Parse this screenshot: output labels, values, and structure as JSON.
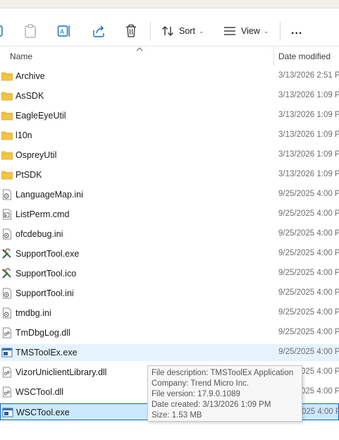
{
  "toolbar": {
    "sort_label": "Sort",
    "view_label": "View",
    "more_label": "..."
  },
  "header": {
    "name_label": "Name",
    "date_label": "Date modified"
  },
  "files": [
    {
      "name": "Archive",
      "date": "3/13/2026 2:51 P",
      "icon": "folder-icon"
    },
    {
      "name": "AsSDK",
      "date": "3/13/2026 1:09 P",
      "icon": "folder-icon"
    },
    {
      "name": "EagleEyeUtil",
      "date": "3/13/2026 1:09 P",
      "icon": "folder-icon"
    },
    {
      "name": "l10n",
      "date": "3/13/2026 1:09 P",
      "icon": "folder-icon"
    },
    {
      "name": "OspreyUtil",
      "date": "3/13/2026 1:09 P",
      "icon": "folder-icon"
    },
    {
      "name": "PtSDK",
      "date": "3/13/2026 1:09 P",
      "icon": "folder-icon"
    },
    {
      "name": "LanguageMap.ini",
      "date": "9/25/2025 4:00 P",
      "icon": "settings-file-icon"
    },
    {
      "name": "ListPerm.cmd",
      "date": "9/25/2025 4:00 P",
      "icon": "cmd-file-icon"
    },
    {
      "name": "ofcdebug.ini",
      "date": "9/25/2025 4:00 P",
      "icon": "settings-file-icon"
    },
    {
      "name": "SupportTool.exe",
      "date": "9/25/2025 4:00 P",
      "icon": "tools-icon"
    },
    {
      "name": "SupportTool.ico",
      "date": "9/25/2025 4:00 P",
      "icon": "tools-icon"
    },
    {
      "name": "SupportTool.ini",
      "date": "9/25/2025 4:00 P",
      "icon": "settings-file-icon"
    },
    {
      "name": "tmdbg.ini",
      "date": "9/25/2025 4:00 P",
      "icon": "settings-file-icon"
    },
    {
      "name": "TmDbgLog.dll",
      "date": "9/25/2025 4:00 P",
      "icon": "dll-file-icon"
    },
    {
      "name": "TMSToolEx.exe",
      "date": "9/25/2025 4:00 P",
      "icon": "exe-file-icon"
    },
    {
      "name": "VizorUniclientLibrary.dll",
      "date": "9/25/2025 4:00 P",
      "icon": "dll-file-icon"
    },
    {
      "name": "WSCTool.dll",
      "date": "9/25/2025 4:00 P",
      "icon": "dll-file-icon"
    },
    {
      "name": "WSCTool.exe",
      "date": "9/25/2025 4:00 P",
      "icon": "exe-file-icon"
    }
  ],
  "tooltip": {
    "description": "File description: TMSToolEx Application",
    "company": "Company: Trend Micro Inc.",
    "version": "File version: 17.9.0.1089",
    "created": "Date created: 3/13/2026 1:09 PM",
    "size": "Size: 1.53 MB"
  },
  "colors": {
    "hover_row": "#e5f3ff",
    "selected_row": "#cce8ff",
    "selected_border": "#0b61d6",
    "folder": "#f4c542"
  }
}
